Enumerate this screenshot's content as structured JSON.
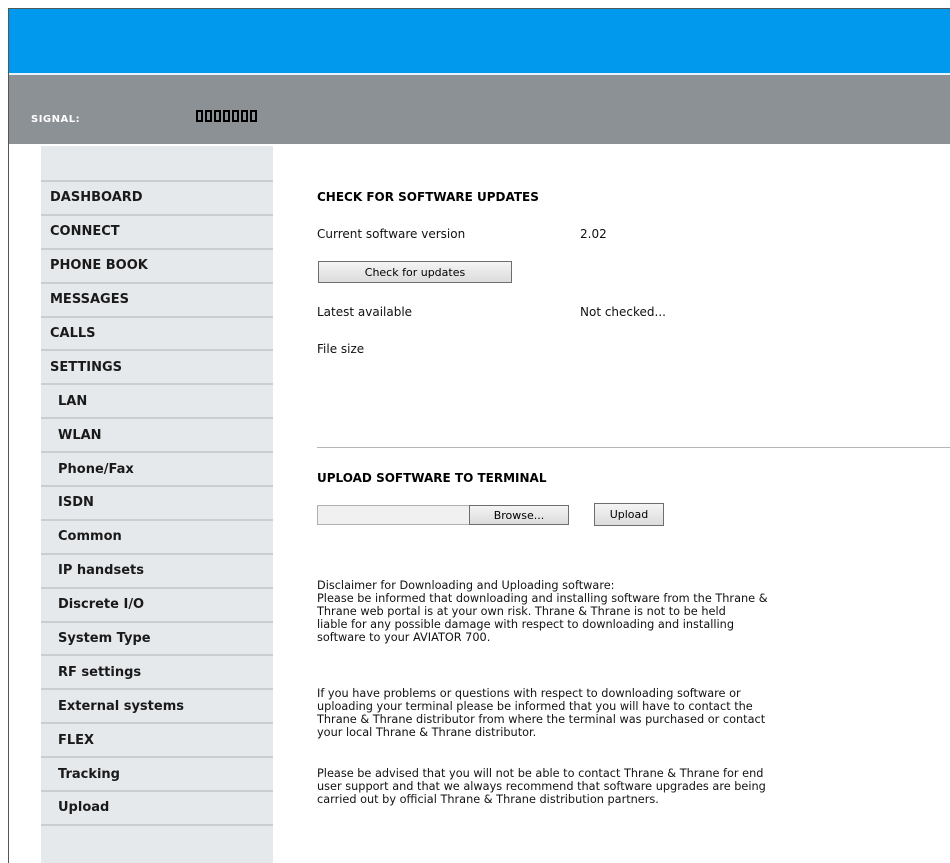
{
  "header": {
    "signal_label": "SIGNAL:",
    "signal_bars": 7,
    "colors": {
      "topbar": "#0099ee",
      "signalbar": "#8c9196"
    }
  },
  "sidebar": {
    "items": [
      {
        "label": "DASHBOARD",
        "sub": false
      },
      {
        "label": "CONNECT",
        "sub": false
      },
      {
        "label": "PHONE BOOK",
        "sub": false
      },
      {
        "label": "MESSAGES",
        "sub": false
      },
      {
        "label": "CALLS",
        "sub": false
      },
      {
        "label": "SETTINGS",
        "sub": false
      },
      {
        "label": "LAN",
        "sub": true
      },
      {
        "label": "WLAN",
        "sub": true
      },
      {
        "label": "Phone/Fax",
        "sub": true
      },
      {
        "label": "ISDN",
        "sub": true
      },
      {
        "label": "Common",
        "sub": true
      },
      {
        "label": "IP handsets",
        "sub": true
      },
      {
        "label": "Discrete I/O",
        "sub": true
      },
      {
        "label": "System Type",
        "sub": true
      },
      {
        "label": "RF settings",
        "sub": true
      },
      {
        "label": "External systems",
        "sub": true
      },
      {
        "label": "FLEX",
        "sub": true
      },
      {
        "label": "Tracking",
        "sub": true
      },
      {
        "label": "Upload",
        "sub": true
      }
    ]
  },
  "check": {
    "title": "CHECK FOR SOFTWARE UPDATES",
    "current_label": "Current software version",
    "current_value": "2.02",
    "check_button": "Check for updates",
    "latest_label": "Latest available",
    "latest_value": "Not checked...",
    "filesize_label": "File size"
  },
  "upload": {
    "title": "UPLOAD SOFTWARE TO TERMINAL",
    "browse_button": "Browse...",
    "upload_button": "Upload"
  },
  "disclaimer": {
    "p1": [
      "Disclaimer for Downloading and Uploading software:",
      "Please be informed that downloading and installing software from the Thrane &",
      "Thrane web portal is at your own risk. Thrane & Thrane is not to be held",
      "liable for any possible damage with respect to downloading and installing",
      "software to your AVIATOR 700."
    ],
    "p2": [
      "If you have problems or questions with respect to downloading software or",
      "uploading your terminal please be informed that you will have to contact the",
      "Thrane & Thrane distributor from where the terminal was purchased or contact",
      "your local Thrane & Thrane distributor."
    ],
    "p3": [
      "Please be advised that you will not be able to contact Thrane & Thrane for end",
      "user support and that we always recommend that software upgrades are being",
      "carried out by official Thrane & Thrane distribution partners."
    ]
  }
}
